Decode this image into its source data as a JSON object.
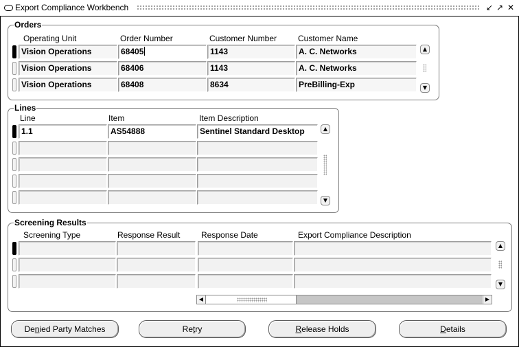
{
  "window": {
    "title": "Export Compliance Workbench",
    "controls": {
      "minimize": "↙",
      "maximize": "↗",
      "close": "✕"
    }
  },
  "orders": {
    "label": "Orders",
    "columns": [
      "Operating Unit",
      "Order Number",
      "Customer Number",
      "Customer Name"
    ],
    "rows": [
      [
        "Vision Operations",
        "68405",
        "1143",
        "A. C. Networks"
      ],
      [
        "Vision Operations",
        "68406",
        "1143",
        "A. C. Networks"
      ],
      [
        "Vision Operations",
        "68408",
        "8634",
        "PreBilling-Exp"
      ]
    ]
  },
  "lines": {
    "label": "Lines",
    "columns": [
      "Line",
      "Item",
      "Item Description"
    ],
    "rows": [
      [
        "1.1",
        "AS54888",
        "Sentinel Standard Desktop"
      ],
      [
        "",
        "",
        ""
      ],
      [
        "",
        "",
        ""
      ],
      [
        "",
        "",
        ""
      ],
      [
        "",
        "",
        ""
      ]
    ]
  },
  "screening": {
    "label": "Screening Results",
    "columns": [
      "Screening Type",
      "Response Result",
      "Response Date",
      "Export Compliance Description"
    ],
    "rows": [
      [
        "",
        "",
        "",
        ""
      ],
      [
        "",
        "",
        "",
        ""
      ],
      [
        "",
        "",
        "",
        ""
      ]
    ]
  },
  "buttons": {
    "denied_party": {
      "pre": "De",
      "key": "n",
      "post": "ied Party Matches"
    },
    "retry": {
      "pre": "Re",
      "key": "t",
      "post": "ry"
    },
    "release_holds": {
      "pre": "",
      "key": "R",
      "post": "elease Holds"
    },
    "details": {
      "pre": "",
      "key": "D",
      "post": "etails"
    }
  }
}
